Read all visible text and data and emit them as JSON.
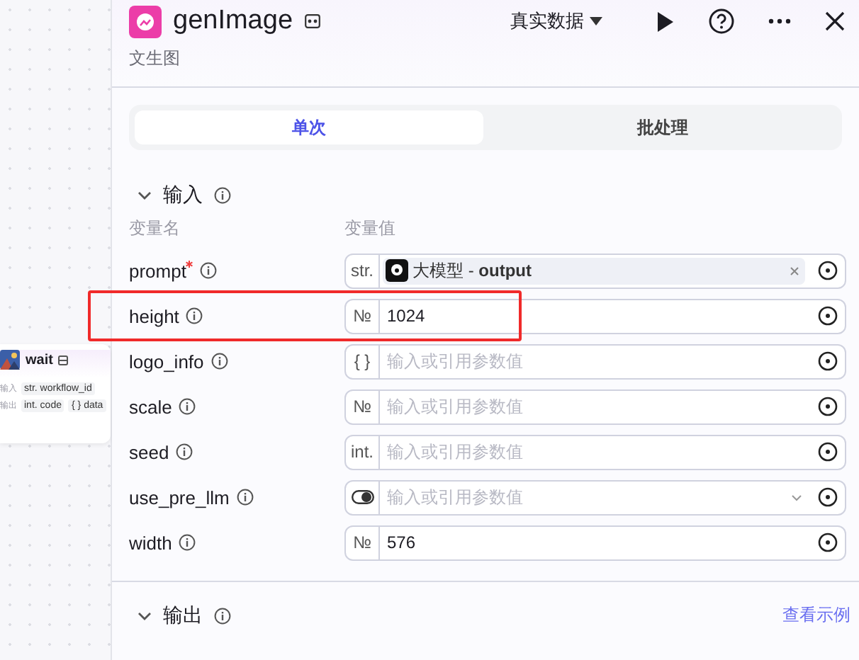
{
  "canvas_node": {
    "title": "wait",
    "rows": [
      {
        "label": "输入",
        "params": [
          {
            "type": "str.",
            "name": "workflow_id"
          }
        ]
      },
      {
        "label": "输出",
        "params": [
          {
            "type": "int.",
            "name": "code"
          },
          {
            "type": "{ }",
            "name": "data"
          }
        ]
      }
    ]
  },
  "panel": {
    "title": "genImage",
    "subtitle": "文生图",
    "data_source": "真实数据"
  },
  "tabs": [
    {
      "label": "单次",
      "selected": true
    },
    {
      "label": "批处理",
      "selected": false
    }
  ],
  "inputs": {
    "title": "输入",
    "column_headers": [
      "变量名",
      "变量值"
    ],
    "rows": [
      {
        "name": "prompt",
        "required": true,
        "highlighted": false,
        "kind": "reference",
        "type_tag": "str.",
        "value": "大模型 - **output**"
      },
      {
        "name": "height",
        "required": false,
        "highlighted": true,
        "kind": "text",
        "type_tag": "№",
        "value": "1024"
      },
      {
        "name": "logo_info",
        "required": false,
        "highlighted": false,
        "kind": "text",
        "type_tag": "{ }",
        "placeholder": "输入或引用参数值"
      },
      {
        "name": "scale",
        "required": false,
        "highlighted": false,
        "kind": "text",
        "type_tag": "№",
        "placeholder": "输入或引用参数值"
      },
      {
        "name": "seed",
        "required": false,
        "highlighted": false,
        "kind": "text",
        "type_tag": "int.",
        "placeholder": "输入或引用参数值"
      },
      {
        "name": "use_pre_llm",
        "required": false,
        "highlighted": false,
        "kind": "boolean",
        "placeholder": "输入或引用参数值"
      },
      {
        "name": "width",
        "required": false,
        "highlighted": false,
        "kind": "text",
        "type_tag": "№",
        "value": "576"
      }
    ]
  },
  "outputs": {
    "title": "输出",
    "link": "查看示例"
  }
}
